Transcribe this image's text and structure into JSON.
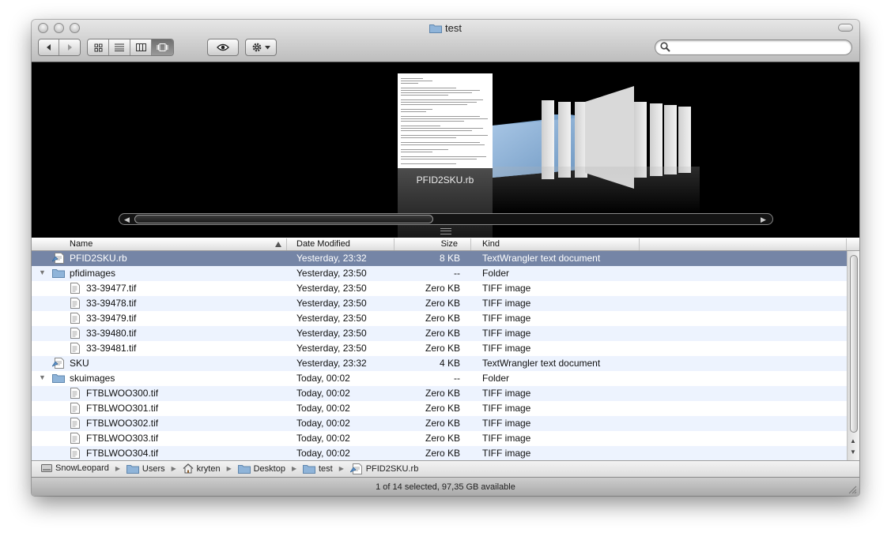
{
  "window": {
    "title": "test"
  },
  "toolbar": {
    "back_label": "Back",
    "forward_label": "Forward",
    "views": [
      "icon-view",
      "list-view",
      "column-view",
      "cover-flow-view"
    ],
    "active_view": "cover-flow-view",
    "quicklook": "eye-icon",
    "action": "gear-icon",
    "search_placeholder": ""
  },
  "coverflow": {
    "selected_label": "PFID2SKU.rb"
  },
  "columns": {
    "name": "Name",
    "date": "Date Modified",
    "size": "Size",
    "kind": "Kind"
  },
  "rows": [
    {
      "name": "PFID2SKU.rb",
      "date": "Yesterday, 23:32",
      "size": "8 KB",
      "kind": "TextWrangler text document",
      "level": 0,
      "icon": "script-icon",
      "selected": true
    },
    {
      "name": "pfidimages",
      "date": "Yesterday, 23:50",
      "size": "--",
      "kind": "Folder",
      "level": 0,
      "icon": "folder-icon",
      "expanded": true
    },
    {
      "name": "33-39477.tif",
      "date": "Yesterday, 23:50",
      "size": "Zero KB",
      "kind": "TIFF image",
      "level": 1,
      "icon": "document-icon"
    },
    {
      "name": "33-39478.tif",
      "date": "Yesterday, 23:50",
      "size": "Zero KB",
      "kind": "TIFF image",
      "level": 1,
      "icon": "document-icon"
    },
    {
      "name": "33-39479.tif",
      "date": "Yesterday, 23:50",
      "size": "Zero KB",
      "kind": "TIFF image",
      "level": 1,
      "icon": "document-icon"
    },
    {
      "name": "33-39480.tif",
      "date": "Yesterday, 23:50",
      "size": "Zero KB",
      "kind": "TIFF image",
      "level": 1,
      "icon": "document-icon"
    },
    {
      "name": "33-39481.tif",
      "date": "Yesterday, 23:50",
      "size": "Zero KB",
      "kind": "TIFF image",
      "level": 1,
      "icon": "document-icon"
    },
    {
      "name": "SKU",
      "date": "Yesterday, 23:32",
      "size": "4 KB",
      "kind": "TextWrangler text document",
      "level": 0,
      "icon": "script-icon"
    },
    {
      "name": "skuimages",
      "date": "Today, 00:02",
      "size": "--",
      "kind": "Folder",
      "level": 0,
      "icon": "folder-icon",
      "expanded": true
    },
    {
      "name": "FTBLWOO300.tif",
      "date": "Today, 00:02",
      "size": "Zero KB",
      "kind": "TIFF image",
      "level": 1,
      "icon": "document-icon"
    },
    {
      "name": "FTBLWOO301.tif",
      "date": "Today, 00:02",
      "size": "Zero KB",
      "kind": "TIFF image",
      "level": 1,
      "icon": "document-icon"
    },
    {
      "name": "FTBLWOO302.tif",
      "date": "Today, 00:02",
      "size": "Zero KB",
      "kind": "TIFF image",
      "level": 1,
      "icon": "document-icon"
    },
    {
      "name": "FTBLWOO303.tif",
      "date": "Today, 00:02",
      "size": "Zero KB",
      "kind": "TIFF image",
      "level": 1,
      "icon": "document-icon"
    },
    {
      "name": "FTBLWOO304.tif",
      "date": "Today, 00:02",
      "size": "Zero KB",
      "kind": "TIFF image",
      "level": 1,
      "icon": "document-icon"
    }
  ],
  "pathbar": [
    {
      "label": "SnowLeopard",
      "icon": "hard-drive-icon"
    },
    {
      "label": "Users",
      "icon": "folder-icon"
    },
    {
      "label": "kryten",
      "icon": "home-icon"
    },
    {
      "label": "Desktop",
      "icon": "folder-icon"
    },
    {
      "label": "test",
      "icon": "folder-icon"
    },
    {
      "label": "PFID2SKU.rb",
      "icon": "script-icon"
    }
  ],
  "status": {
    "text": "1 of 14 selected, 97,35 GB available"
  },
  "colors": {
    "selection": "#7585a6",
    "alt_row": "#edf3fe",
    "folder": "#8fb4d9"
  }
}
